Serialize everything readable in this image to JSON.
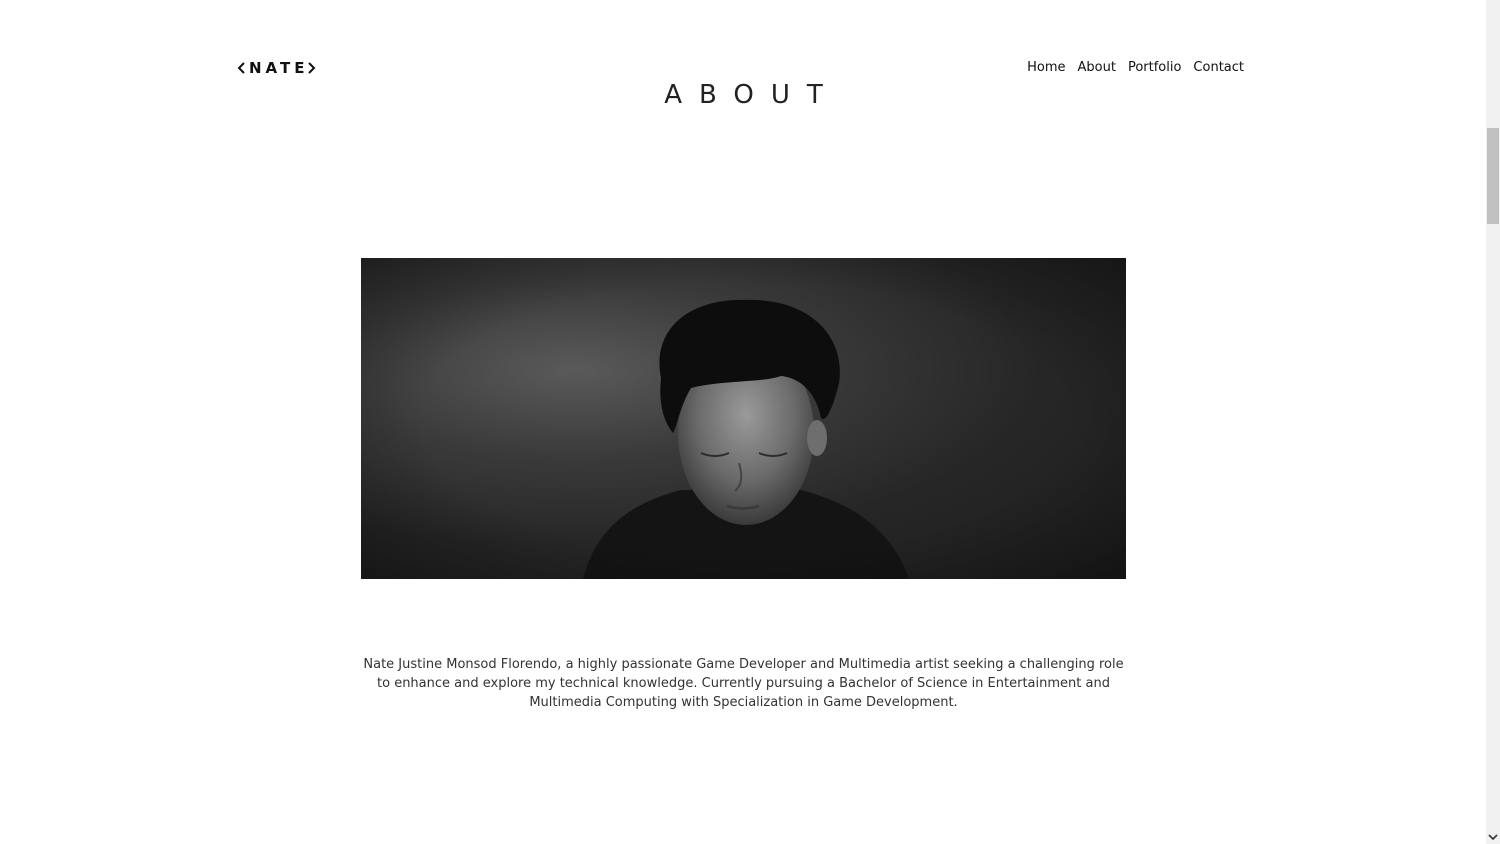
{
  "header": {
    "logo": "NATE",
    "nav": [
      {
        "label": "Home"
      },
      {
        "label": "About"
      },
      {
        "label": "Portfolio"
      },
      {
        "label": "Contact"
      }
    ]
  },
  "main": {
    "title": "ABOUT",
    "bio": "Nate Justine Monsod Florendo, a highly passionate Game Developer and Multimedia artist seeking a challenging role to enhance and explore my technical knowledge. Currently pursuing a Bachelor of Science in Entertainment and Multimedia Computing with Specialization in Game Development."
  },
  "icons": {
    "logo_left": "chevron-left-icon",
    "logo_right": "chevron-right-icon",
    "scroll_down": "chevron-down-icon"
  },
  "colors": {
    "background": "#ffffff",
    "text": "#222222",
    "photo_dark": "#1e1e1e"
  }
}
